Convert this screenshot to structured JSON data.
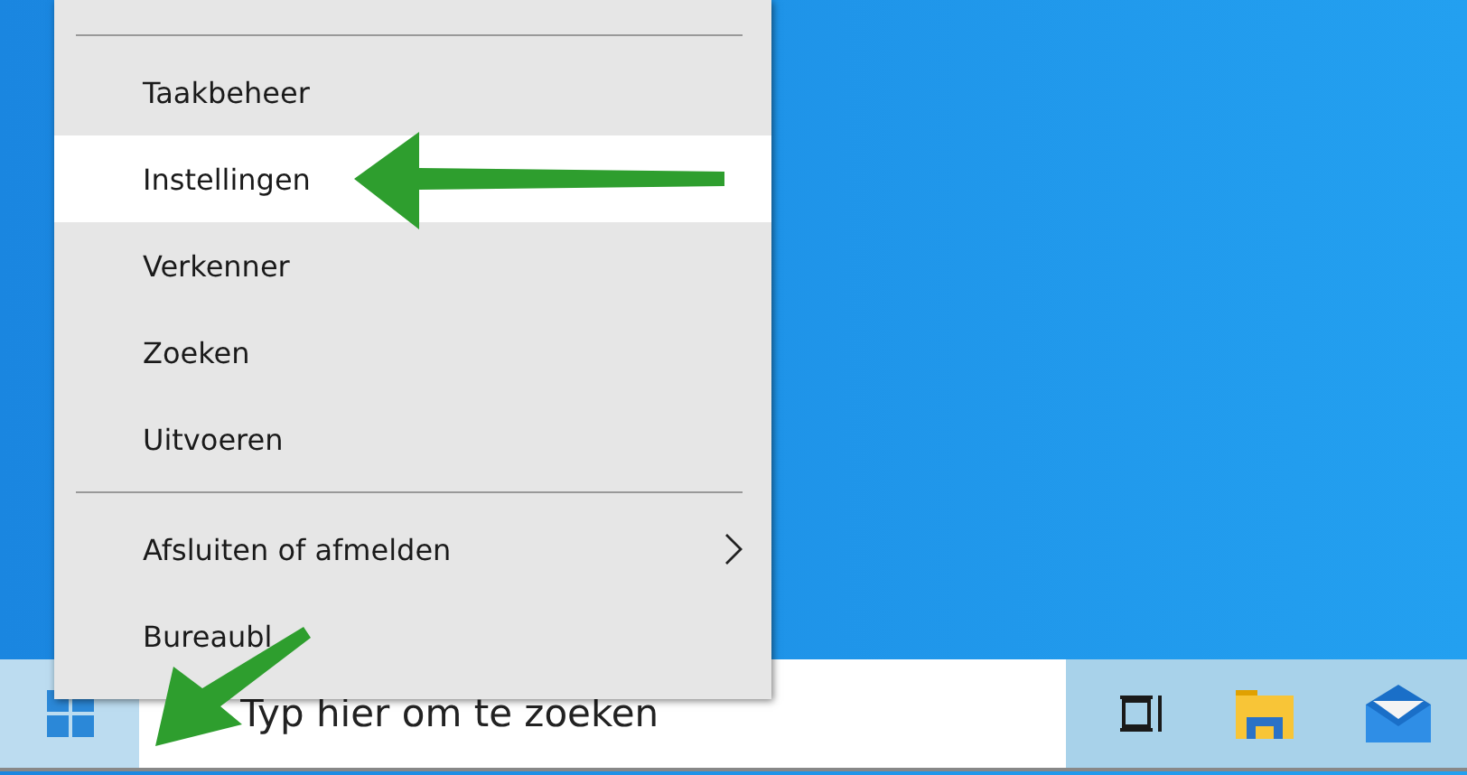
{
  "context_menu": {
    "sections": [
      {
        "items": [
          {
            "label": "Taakbeheer",
            "selected": false,
            "submenu": false
          },
          {
            "label": "Instellingen",
            "selected": true,
            "submenu": false
          },
          {
            "label": "Verkenner",
            "selected": false,
            "submenu": false
          },
          {
            "label": "Zoeken",
            "selected": false,
            "submenu": false
          },
          {
            "label": "Uitvoeren",
            "selected": false,
            "submenu": false
          }
        ]
      },
      {
        "items": [
          {
            "label": "Afsluiten of afmelden",
            "selected": false,
            "submenu": true
          },
          {
            "label": "Bureaubl",
            "selected": false,
            "submenu": false
          }
        ]
      }
    ]
  },
  "taskbar": {
    "search": {
      "placeholder": "Typ hier om te zoeken"
    }
  }
}
